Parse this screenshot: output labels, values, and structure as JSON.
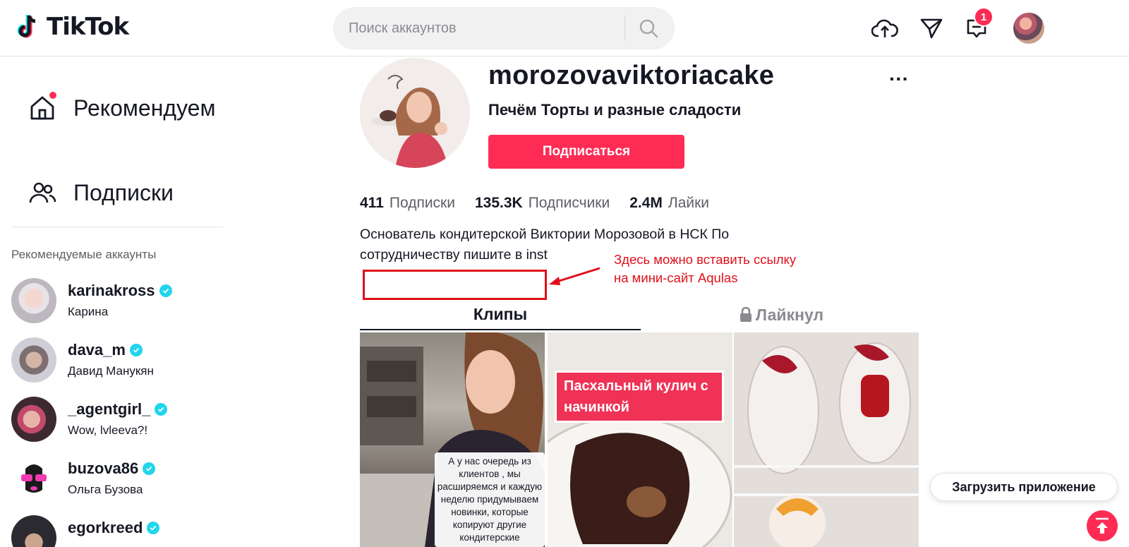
{
  "header": {
    "logo_text": "TikTok",
    "search_placeholder": "Поиск аккаунтов",
    "notification_count": "1"
  },
  "sidebar": {
    "nav": [
      {
        "label": "Рекомендуем",
        "icon": "home-icon"
      },
      {
        "label": "Подписки",
        "icon": "users-icon"
      }
    ],
    "suggested_heading": "Рекомендуемые аккаунты",
    "accounts": [
      {
        "username": "karinakross",
        "name": "Карина",
        "verified": true
      },
      {
        "username": "dava_m",
        "name": "Давид Манукян",
        "verified": true
      },
      {
        "username": "_agentgirl_",
        "name": "Wow, lvleeva?!",
        "verified": true
      },
      {
        "username": "buzova86",
        "name": "Ольга Бузова",
        "verified": true
      },
      {
        "username": "egorkreed",
        "name": "",
        "verified": true
      }
    ]
  },
  "profile": {
    "username": "morozovaviktoriacake",
    "nickname": "Печём Торты и разные сладости",
    "follow_label": "Подписаться",
    "more_label": "···",
    "stats": [
      {
        "value": "411",
        "label": "Подписки"
      },
      {
        "value": "135.3K",
        "label": "Подписчики"
      },
      {
        "value": "2.4M",
        "label": "Лайки"
      }
    ],
    "bio_line1": "Основатель кондитерской Виктории Морозовой в НСК По",
    "bio_line2": "сотрудничеству пишите в inst",
    "annotation_line1": "Здесь можно вставить ссылку",
    "annotation_line2": "на мини-сайт Aqulas"
  },
  "tabs": [
    {
      "label": "Клипы",
      "active": true
    },
    {
      "label": "Лайкнул",
      "active": false,
      "locked": true
    }
  ],
  "videos": [
    {
      "overlay_text": "А у нас очередь из клиентов , мы расширяемся и каждую неделю придумываем новинки, которые копируют другие кондитерские"
    },
    {
      "overlay_text": "Пасхальный кулич с начинкой"
    },
    {
      "overlay_text": ""
    }
  ],
  "footer": {
    "get_app_label": "Загрузить приложение"
  },
  "colors": {
    "brand_red": "#fe2c55",
    "annotation_red": "#e0101a",
    "verified_cyan": "#20d5ec"
  }
}
